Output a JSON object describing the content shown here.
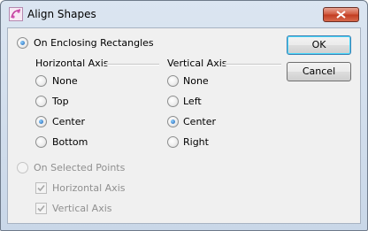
{
  "window": {
    "title": "Align Shapes",
    "accent": "#c13b20"
  },
  "enclosing": {
    "label": "On Enclosing Rectangles",
    "checked": true
  },
  "horizontal": {
    "header": "Horizontal Axis",
    "options": [
      "None",
      "Top",
      "Center",
      "Bottom"
    ],
    "selected": "Center"
  },
  "vertical": {
    "header": "Vertical Axis",
    "options": [
      "None",
      "Left",
      "Center",
      "Right"
    ],
    "selected": "Center"
  },
  "selected_points": {
    "label": "On Selected Points",
    "checked": false,
    "disabled": true,
    "checkboxes": [
      {
        "label": "Horizontal Axis",
        "checked": true
      },
      {
        "label": "Vertical Axis",
        "checked": true
      }
    ]
  },
  "buttons": {
    "ok": "OK",
    "cancel": "Cancel"
  }
}
